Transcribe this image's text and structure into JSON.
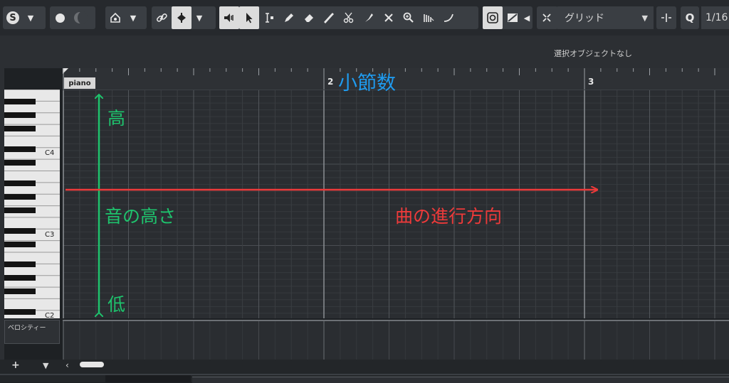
{
  "toolbar": {
    "solo_icon": "S",
    "grid_type": "グリッド",
    "quantize_label": "Q",
    "quantize_value": "1/16"
  },
  "status": {
    "selection": "選択オブジェクトなし"
  },
  "ruler": {
    "track_name": "piano",
    "measures": [
      "2",
      "3"
    ]
  },
  "piano": {
    "labels": [
      "C4",
      "C3",
      "C2"
    ]
  },
  "velocity": {
    "label": "ベロシティー"
  },
  "annotations": {
    "measure_label": "小節数",
    "high_label": "高",
    "pitch_label": "音の高さ",
    "low_label": "低",
    "direction_label": "曲の進行方向",
    "colors": {
      "measure": "#1f9bef",
      "pitch": "#1ec36d",
      "direction": "#ee3a3a"
    }
  },
  "bottom": {
    "add_label": "+",
    "menu_label": "▼"
  }
}
